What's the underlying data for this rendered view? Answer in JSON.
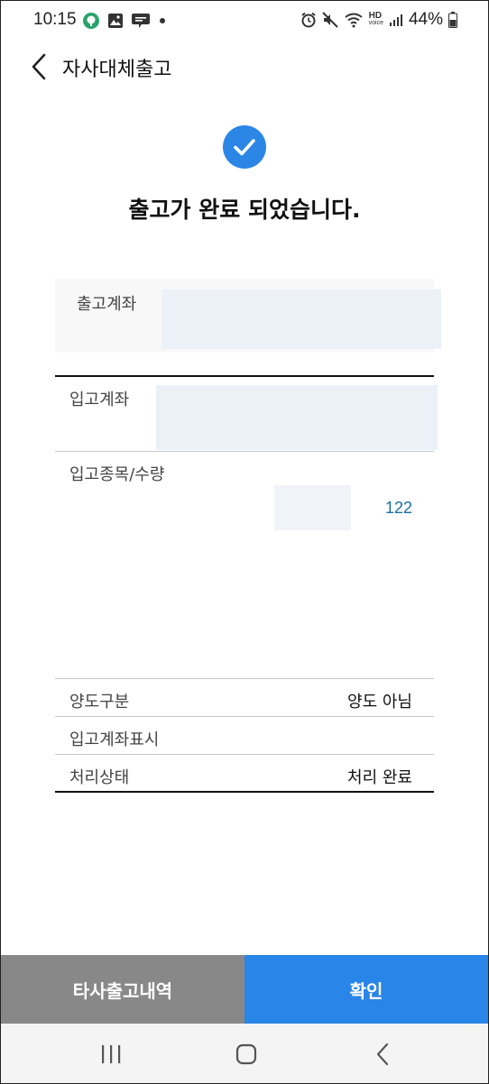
{
  "status_bar": {
    "time": "10:15",
    "hd_label": "HD",
    "voice_label": "voice",
    "battery_percent": "44%",
    "left_icons": [
      "talk-icon",
      "gallery-icon",
      "blog-icon",
      "dot-icon"
    ],
    "right_icons": [
      "alarm-icon",
      "mute-icon",
      "wifi-icon",
      "signal-icon",
      "battery-icon"
    ]
  },
  "header": {
    "title": "자사대체출고",
    "back_icon": "chevron-left-icon"
  },
  "success": {
    "message": "출고가 완료 되었습니다.",
    "icon": "check-icon",
    "accent_color": "#2b86e6"
  },
  "details": {
    "out_account_label": "출고계좌",
    "in_account_label": "입고계좌",
    "item_quantity_label": "입고종목/수량",
    "quantity_value": "122",
    "transfer_type_label": "양도구분",
    "transfer_type_value": "양도 아님",
    "in_account_display_label": "입고계좌표시",
    "status_label": "처리상태",
    "status_value": "처리 완료"
  },
  "buttons": {
    "history_label": "타사출고내역",
    "confirm_label": "확인",
    "history_color": "#888888",
    "confirm_color": "#2985e7"
  },
  "nav_bar": {
    "icons": [
      "recent-apps-icon",
      "home-icon",
      "back-icon"
    ]
  }
}
